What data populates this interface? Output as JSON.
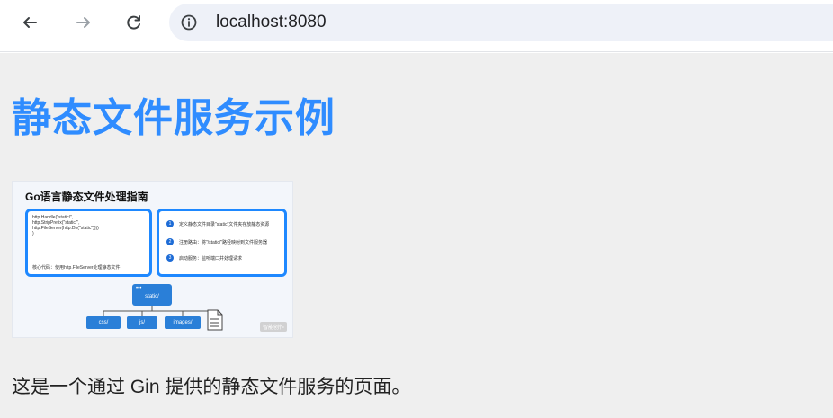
{
  "browser": {
    "url": "localhost:8080",
    "icons": {
      "back": "arrow-left-icon",
      "forward": "arrow-right-icon",
      "reload": "reload-icon",
      "site_info": "info-circle-icon"
    }
  },
  "page": {
    "title": "静态文件服务示例",
    "description": "这是一个通过 Gin 提供的静态文件服务的页面。",
    "title_color": "#2f8cff",
    "background_color": "#efefef"
  },
  "figure": {
    "title": "Go语言静态文件处理指南",
    "code_lines": [
      "http.Handle(\"static/\",",
      "    http.StripPrefix(\"static/\",",
      "    http.FileServer(http.Dir(\"static\"))))",
      ")"
    ],
    "code_note": "核心代码：使用http.FileServer处理静态文件",
    "steps": [
      {
        "num": "1",
        "text": "定义静态文件目录\"static\"文件夹存放静态资源"
      },
      {
        "num": "2",
        "text": "注册路由：将\"/static/\"路径映射到文件服务器"
      },
      {
        "num": "3",
        "text": "启动服务：监听端口并处理请求"
      }
    ],
    "tree_root": "static/",
    "tree_root_dots": "•••",
    "tree_leaves": [
      "css/",
      "js/",
      "images/"
    ],
    "watermark": "智能创作",
    "accent_color": "#1e88ff",
    "node_color": "#2a7fd8"
  }
}
